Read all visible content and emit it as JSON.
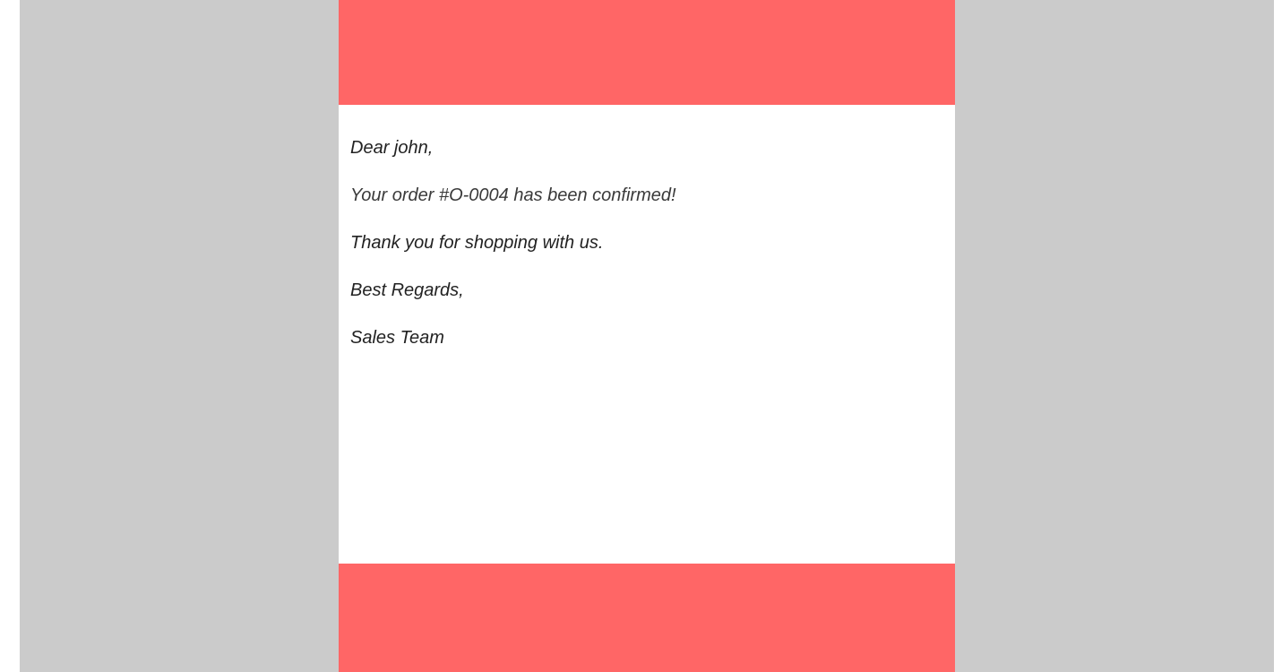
{
  "colors": {
    "backdrop": "#cbcbcb",
    "accent": "#ff6666",
    "body_background": "#ffffff",
    "text": "#222222"
  },
  "email": {
    "greeting": "Dear john,",
    "order_message": "Your order #O-0004 has been confirmed!",
    "thanks": "Thank you for shopping with us.",
    "closing": "Best Regards,",
    "signature": "Sales Team"
  }
}
